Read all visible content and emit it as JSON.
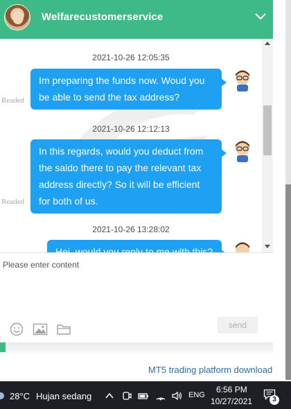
{
  "header": {
    "title": "Welfarecustomerservice",
    "accent_color": "#3dba85",
    "agent_avatar": "agent-avatar-photo",
    "collapse_icon": "chevron-down-icon"
  },
  "messages": [
    {
      "timestamp": "2021-10-26 12:05:35",
      "text": "Im preparing the funds now. Woud you be able to send the tax address?",
      "status": "Readed"
    },
    {
      "timestamp": "2021-10-26 12:12:13",
      "text": "In this regards, would you deduct from the saldo there to pay the relevant tax address directly? So it will be efficient for both of us.",
      "status": "Readed"
    },
    {
      "timestamp": "2021-10-26 13:28:02",
      "text": "Hei, would you reply to me with this?"
    }
  ],
  "bubble_color": "#1ea1f3",
  "composer": {
    "placeholder": "Please enter content",
    "send_label": "send",
    "tools": [
      "emoji-icon",
      "image-icon",
      "folder-icon"
    ]
  },
  "footer": {
    "link_text": "MT5 trading platform download"
  },
  "taskbar": {
    "temperature": "28°C",
    "weather": "Hujan sedang",
    "language": "ENG",
    "time": "6:56 PM",
    "date": "10/27/2021",
    "notification_count": "3"
  }
}
